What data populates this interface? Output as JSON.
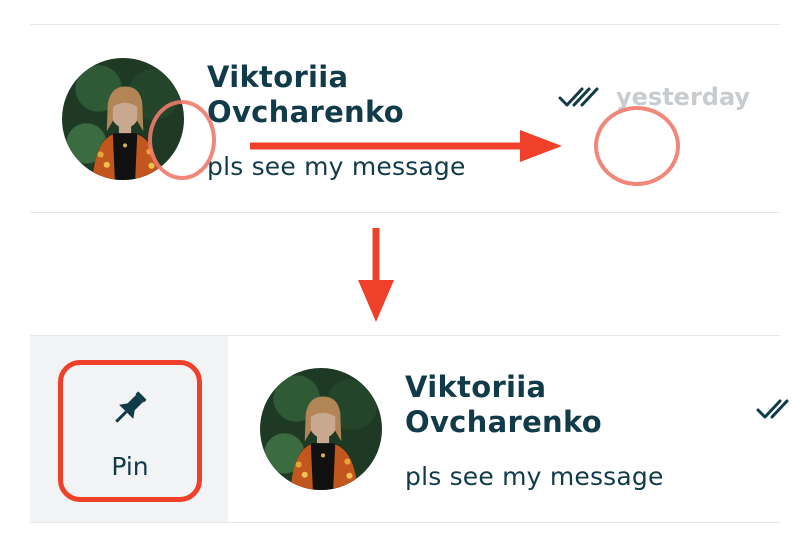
{
  "top_row": {
    "name_line1": "Viktoriia",
    "name_line2": "Ovcharenko",
    "preview": "pls see my message",
    "time": "yesterday",
    "read_status_icon": "double-check-icon"
  },
  "bottom_row": {
    "name_line1": "Viktoriia",
    "name_line2": "Ovcharenko",
    "preview": "pls see my message",
    "read_status_icon": "double-check-icon"
  },
  "pin_action": {
    "label": "Pin",
    "icon": "pushpin-icon"
  },
  "colors": {
    "text": "#123b4a",
    "annotation": "#f1402a",
    "timestamp": "#c9cccf",
    "action_background": "#f2f3f4"
  }
}
